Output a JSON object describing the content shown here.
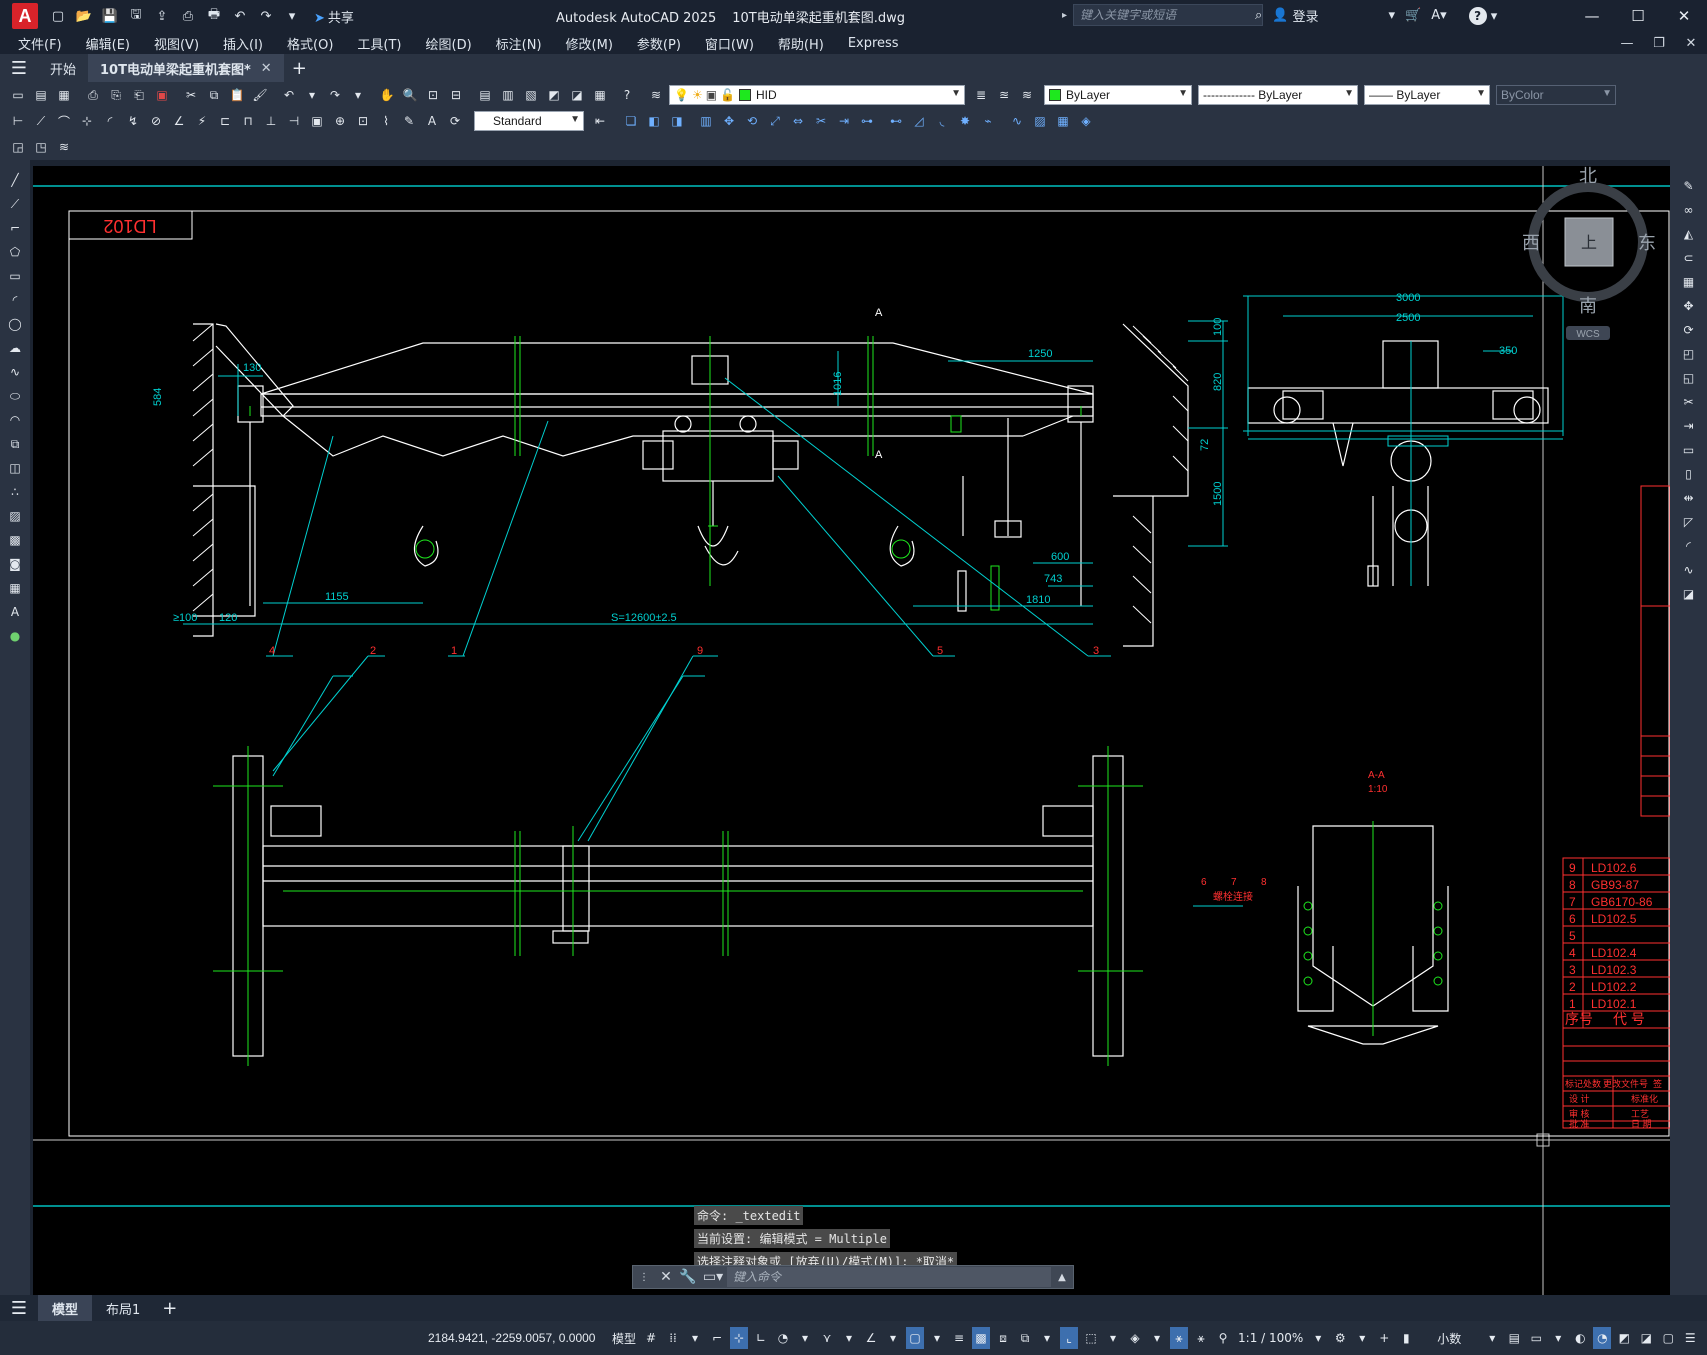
{
  "app": {
    "logo": "A",
    "title": "Autodesk AutoCAD 2025",
    "filename": "10T电动单梁起重机套图.dwg",
    "share_label": "共享",
    "login_label": "登录",
    "help_label": "?"
  },
  "search": {
    "placeholder": "键入关键字或短语"
  },
  "menu": [
    "文件(F)",
    "编辑(E)",
    "视图(V)",
    "插入(I)",
    "格式(O)",
    "工具(T)",
    "绘图(D)",
    "标注(N)",
    "修改(M)",
    "参数(P)",
    "窗口(W)",
    "帮助(H)",
    "Express"
  ],
  "tabs": {
    "start_label": "开始",
    "doc_label": "10T电动单梁起重机套图*",
    "close_glyph": "✕",
    "add_glyph": "+"
  },
  "toolbar": {
    "layer_name": "HID",
    "color_value": "ByLayer",
    "linetype_value": "------------- ByLayer",
    "lineweight_value": "—— ByLayer",
    "plotstyle_value": "ByColor",
    "textstyle_value": "Standard",
    "accent_green": "#1ee81e"
  },
  "viewcube": {
    "north": "北",
    "south": "南",
    "east": "东",
    "west": "西",
    "top_face": "上",
    "wcs_label": "WCS"
  },
  "drawing": {
    "frame_label": "LD102",
    "section_label": "A-A",
    "section_scale": "1:10",
    "section_mark": "A",
    "dims": {
      "d130": "130",
      "d584": "584",
      "d1016": "1016",
      "d1250": "1250",
      "d100": "100",
      "d820": "820",
      "d72": "72",
      "d1500": "1500",
      "d600": "600",
      "d743": "743",
      "d1810": "1810",
      "d1155": "1155",
      "span": "S=12600±2.5",
      "ge100": "≥100",
      "d120": "120",
      "d3000": "3000",
      "d2500": "2500",
      "d350": "350"
    },
    "balloons": [
      "4",
      "2",
      "1",
      "9",
      "5",
      "3"
    ],
    "weld_labels": [
      "6",
      "7",
      "8"
    ],
    "weld_note": "螺栓连接",
    "bom_rows": [
      {
        "no": "9",
        "code": "LD102.6"
      },
      {
        "no": "8",
        "code": "GB93-87"
      },
      {
        "no": "7",
        "code": "GB6170-86"
      },
      {
        "no": "6",
        "code": "LD102.5"
      },
      {
        "no": "5",
        "code": ""
      },
      {
        "no": "4",
        "code": "LD102.4"
      },
      {
        "no": "3",
        "code": "LD102.3"
      },
      {
        "no": "2",
        "code": "LD102.2"
      },
      {
        "no": "1",
        "code": "LD102.1"
      }
    ],
    "bom_header": {
      "no": "序号",
      "code": "代 号"
    },
    "title_block": [
      "标记处数",
      "更改文件号",
      "签",
      "设 计",
      "标准化",
      "工艺",
      "审 核",
      "批 准",
      "日 期"
    ]
  },
  "command": {
    "history": [
      "命令: _textedit",
      "当前设置: 编辑模式 = Multiple",
      "选择注释对象或 [放弃(U)/模式(M)]: *取消*"
    ],
    "placeholder": "键入命令"
  },
  "layout_tabs": {
    "model": "模型",
    "layout1": "布局1",
    "add": "+"
  },
  "status": {
    "coords": "2184.9421, -2259.0057, 0.0000",
    "model_label": "模型",
    "scale": "1:1 / 100%",
    "units": "小数"
  }
}
